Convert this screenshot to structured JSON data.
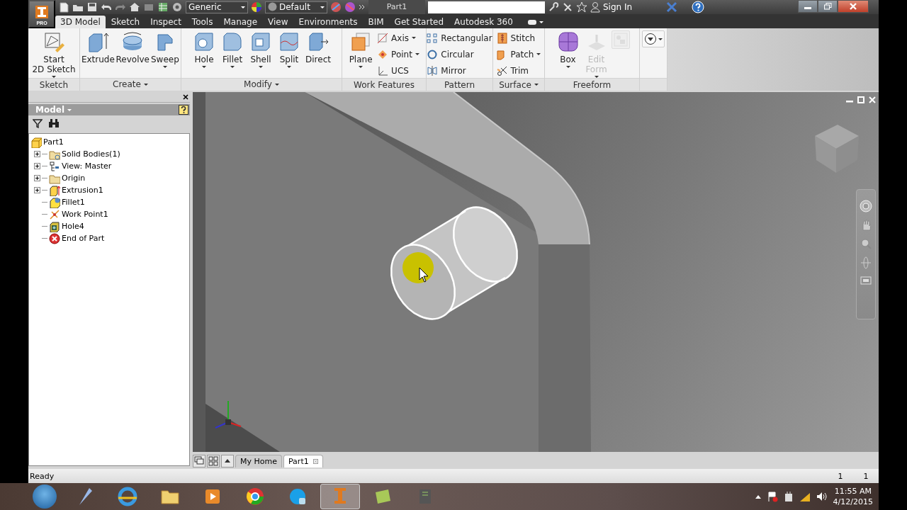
{
  "title_bar": {
    "app_badge": "PRO",
    "material": "Generic",
    "appearance": "Default",
    "document_title": "Part1",
    "sign_in": "Sign In"
  },
  "ribbon_tabs": [
    {
      "label": "3D Model",
      "selected": true
    },
    {
      "label": "Sketch",
      "selected": false
    },
    {
      "label": "Inspect",
      "selected": false
    },
    {
      "label": "Tools",
      "selected": false
    },
    {
      "label": "Manage",
      "selected": false
    },
    {
      "label": "View",
      "selected": false
    },
    {
      "label": "Environments",
      "selected": false
    },
    {
      "label": "BIM",
      "selected": false
    },
    {
      "label": "Get Started",
      "selected": false
    },
    {
      "label": "Autodesk 360",
      "selected": false
    }
  ],
  "ribbon_panels": [
    {
      "label": "Sketch",
      "has_menu": false,
      "tools": [
        {
          "kind": "large",
          "label": "Start\n2D Sketch",
          "dropdown": true,
          "disabled": false
        }
      ]
    },
    {
      "label": "Create",
      "has_menu": true,
      "tools": [
        {
          "kind": "large",
          "label": "Extrude",
          "dropdown": false,
          "disabled": false
        },
        {
          "kind": "large",
          "label": "Revolve",
          "dropdown": false,
          "disabled": false
        },
        {
          "kind": "large",
          "label": "Sweep",
          "dropdown": true,
          "disabled": false
        }
      ]
    },
    {
      "label": "Modify",
      "has_menu": true,
      "tools": [
        {
          "kind": "large",
          "label": "Hole",
          "dropdown": true,
          "disabled": false
        },
        {
          "kind": "large",
          "label": "Fillet",
          "dropdown": true,
          "disabled": false
        },
        {
          "kind": "large",
          "label": "Shell",
          "dropdown": true,
          "disabled": false
        },
        {
          "kind": "large",
          "label": "Split",
          "dropdown": true,
          "disabled": false
        },
        {
          "kind": "large",
          "label": "Direct",
          "dropdown": false,
          "disabled": false
        }
      ]
    },
    {
      "label": "Work Features",
      "has_menu": false,
      "tools": [
        {
          "kind": "large",
          "label": "Plane",
          "dropdown": true,
          "disabled": false
        },
        {
          "kind": "small",
          "label": "Axis",
          "dropdown": true,
          "disabled": false
        },
        {
          "kind": "small",
          "label": "Point",
          "dropdown": true,
          "disabled": false
        },
        {
          "kind": "small",
          "label": "UCS",
          "dropdown": false,
          "disabled": false
        }
      ]
    },
    {
      "label": "Pattern",
      "has_menu": false,
      "tools": [
        {
          "kind": "small",
          "label": "Rectangular",
          "dropdown": false,
          "disabled": false
        },
        {
          "kind": "small",
          "label": "Circular",
          "dropdown": false,
          "disabled": false
        },
        {
          "kind": "small",
          "label": "Mirror",
          "dropdown": false,
          "disabled": false
        }
      ]
    },
    {
      "label": "Surface",
      "has_menu": true,
      "tools": [
        {
          "kind": "small",
          "label": "Stitch",
          "dropdown": false,
          "disabled": false
        },
        {
          "kind": "small",
          "label": "Patch",
          "dropdown": true,
          "disabled": false
        },
        {
          "kind": "small",
          "label": "Trim",
          "dropdown": false,
          "disabled": false
        }
      ]
    },
    {
      "label": "Freeform",
      "has_menu": false,
      "tools": [
        {
          "kind": "large",
          "label": "Box",
          "dropdown": true,
          "disabled": false
        },
        {
          "kind": "large",
          "label": "Edit\nForm",
          "dropdown": true,
          "disabled": true
        },
        {
          "kind": "icon",
          "dropdown": false,
          "disabled": true
        }
      ]
    },
    {
      "has_menu": false,
      "tools": [
        {
          "kind": "icon",
          "dropdown": true,
          "disabled": false
        }
      ]
    }
  ],
  "browser": {
    "title": "Model",
    "tree": [
      {
        "label": "Part1",
        "kind": "part",
        "children": [
          {
            "label": "Solid Bodies(1)",
            "kind": "bodies",
            "expanded": false
          },
          {
            "label": "View: Master",
            "kind": "view",
            "expanded": false
          },
          {
            "label": "Origin",
            "kind": "folder",
            "expanded": false
          },
          {
            "label": "Extrusion1",
            "kind": "extrusion",
            "expanded": false
          },
          {
            "label": "Fillet1",
            "kind": "fillet"
          },
          {
            "label": "Work Point1",
            "kind": "workpoint"
          },
          {
            "label": "Hole4",
            "kind": "hole"
          },
          {
            "label": "End of Part",
            "kind": "end"
          }
        ]
      }
    ]
  },
  "document_tabs": [
    {
      "label": "My Home",
      "selected": false,
      "closable": false
    },
    {
      "label": "Part1",
      "selected": true,
      "closable": true
    }
  ],
  "status_bar": {
    "message": "Ready",
    "count_1": "1",
    "count_2": "1"
  },
  "taskbar": {
    "apps": [
      {
        "active": false
      },
      {
        "active": false
      },
      {
        "active": false
      },
      {
        "active": false
      },
      {
        "active": false
      },
      {
        "active": false
      },
      {
        "active": true
      },
      {
        "active": false
      },
      {
        "active": false
      }
    ],
    "time": "11:55 AM",
    "date": "4/12/2015"
  }
}
